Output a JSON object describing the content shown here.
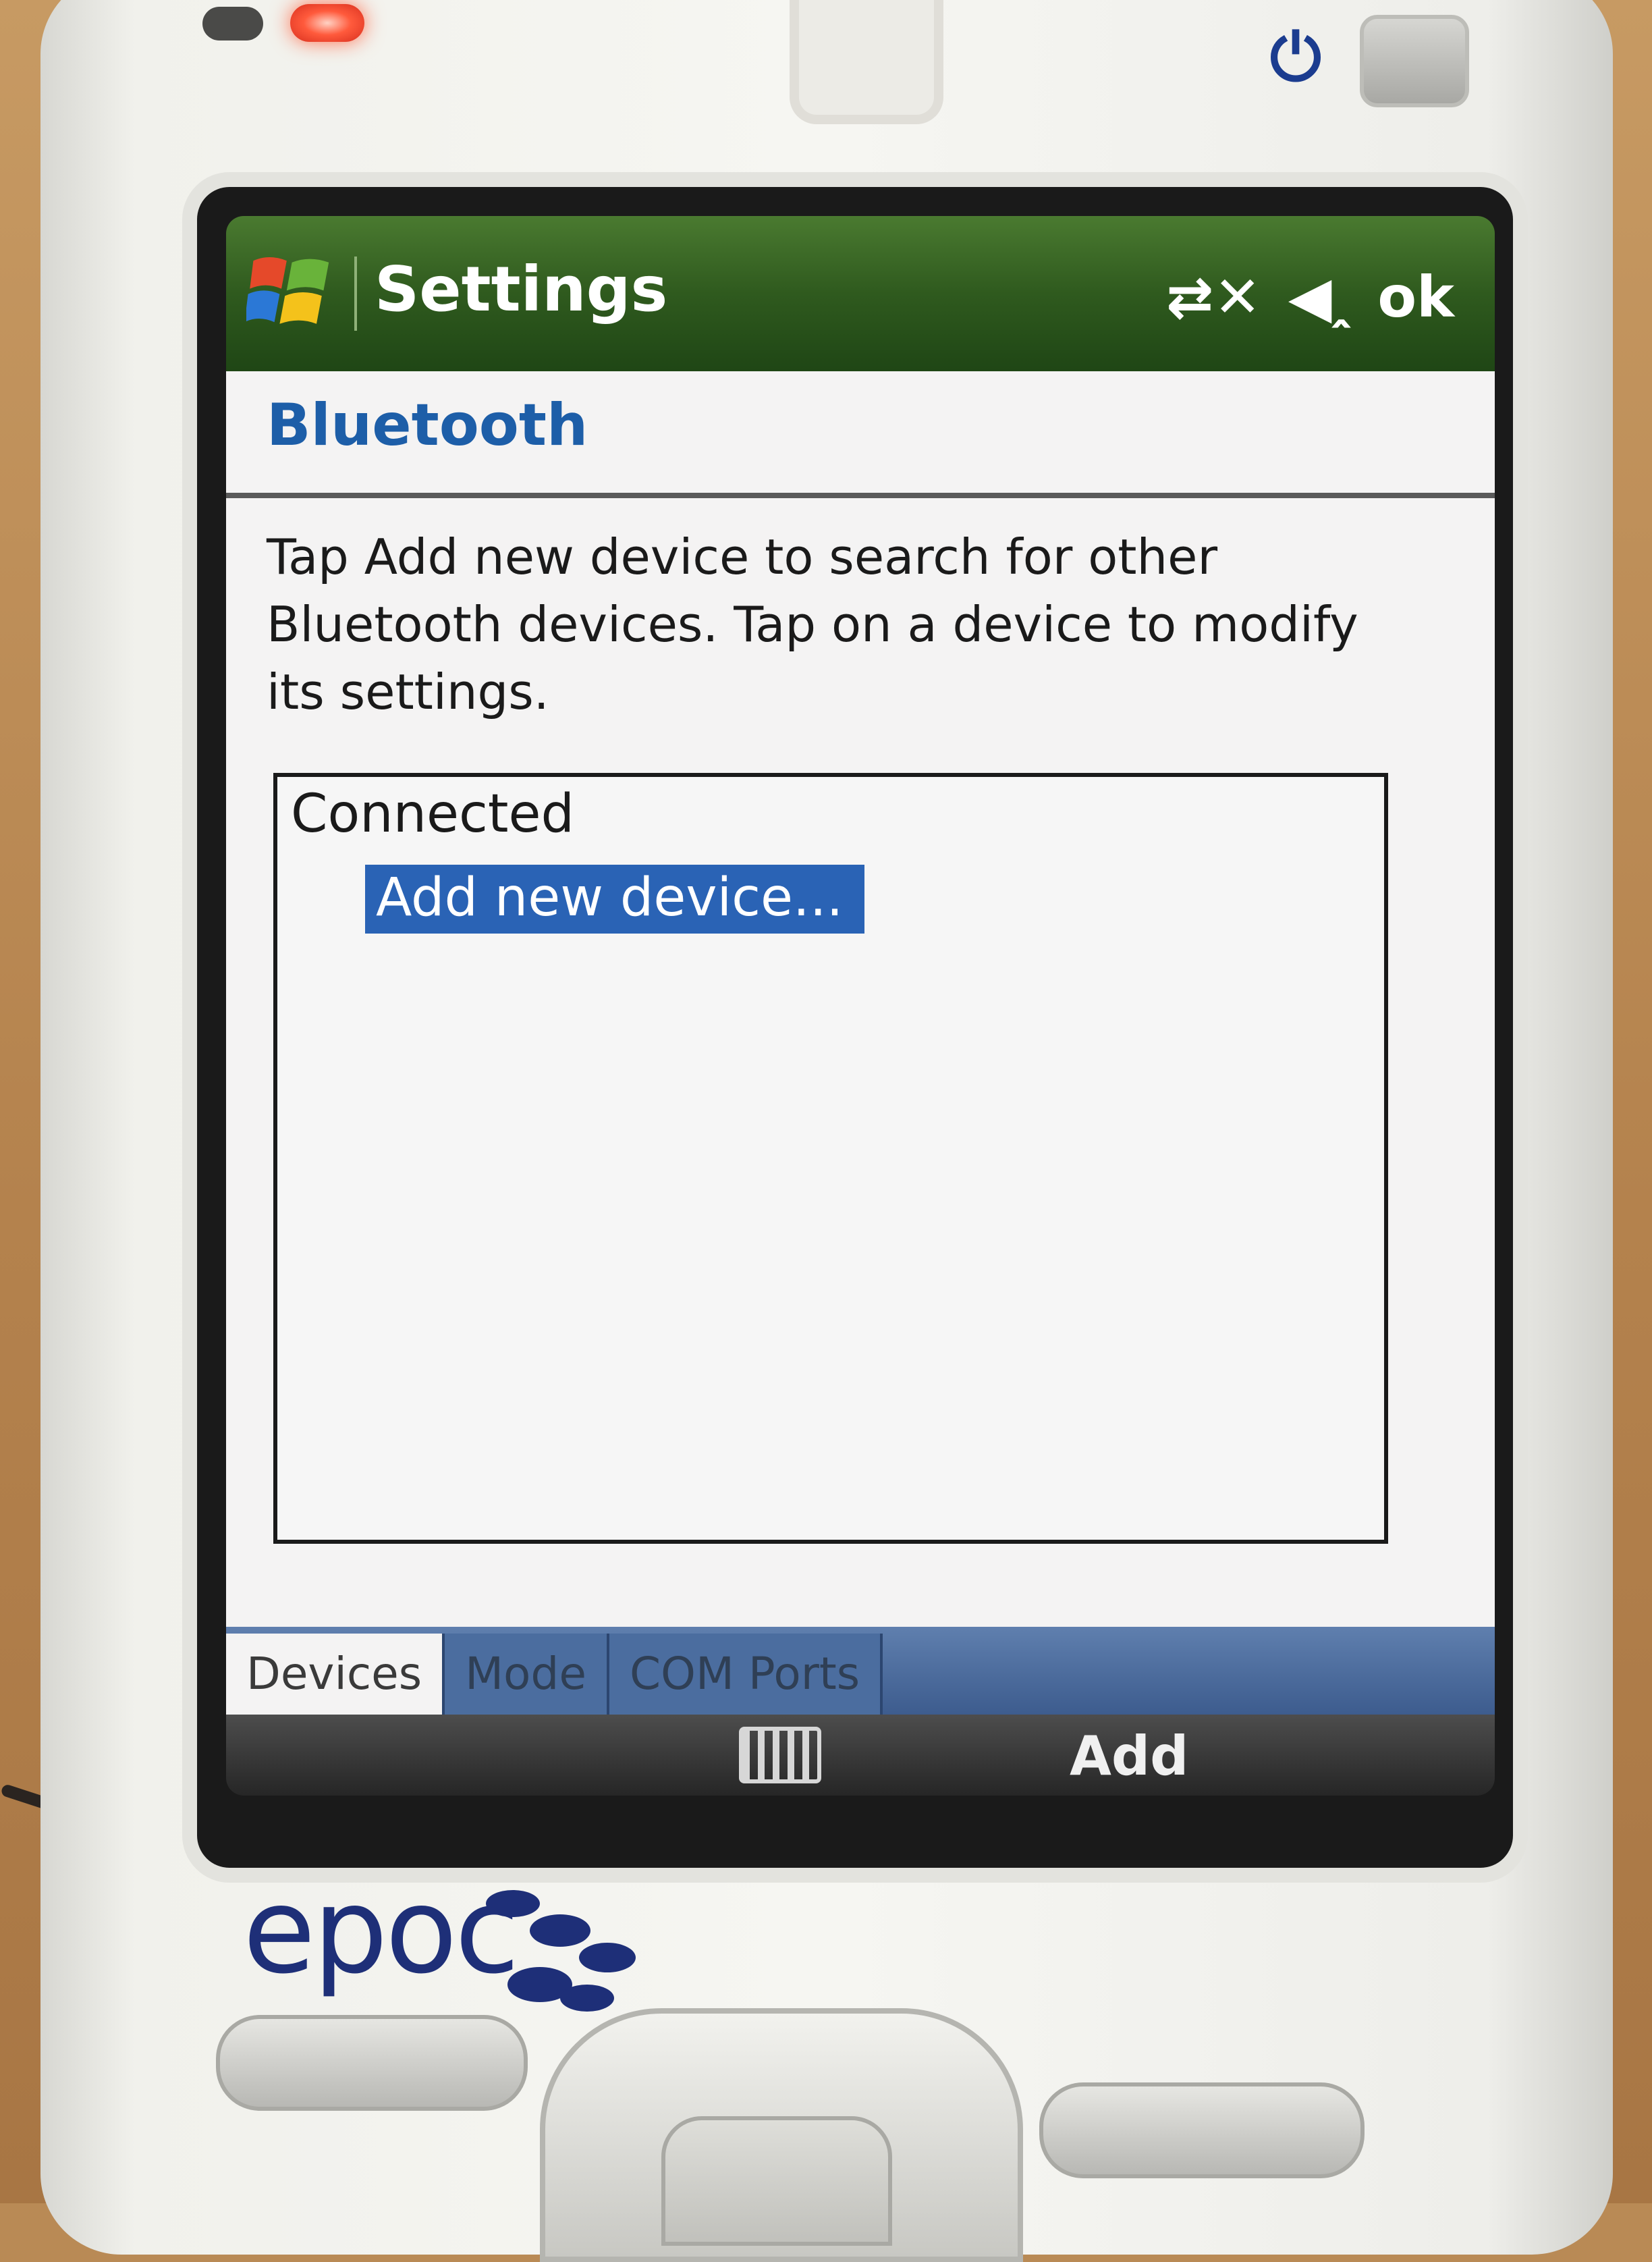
{
  "window": {
    "title": "Settings",
    "ok_label": "ok"
  },
  "status_icons": [
    "connectivity-off-icon",
    "speaker-icon"
  ],
  "page": {
    "heading": "Bluetooth",
    "instructions": "Tap Add new device to search for other Bluetooth devices. Tap on a device to modify its settings."
  },
  "device_list": {
    "group_label": "Connected",
    "items": [
      {
        "label": "Add new device...",
        "selected": true
      }
    ]
  },
  "tabs": [
    {
      "label": "Devices",
      "active": true
    },
    {
      "label": "Mode",
      "active": false
    },
    {
      "label": "COM Ports",
      "active": false
    }
  ],
  "softkeys": {
    "center_icon": "keyboard-icon",
    "right_label": "Add"
  },
  "brand": {
    "name": "epoc"
  },
  "colors": {
    "titlebar": "#2f5a1e",
    "heading": "#1d5ea8",
    "selection": "#2a63b5",
    "brand": "#1e2f78"
  }
}
